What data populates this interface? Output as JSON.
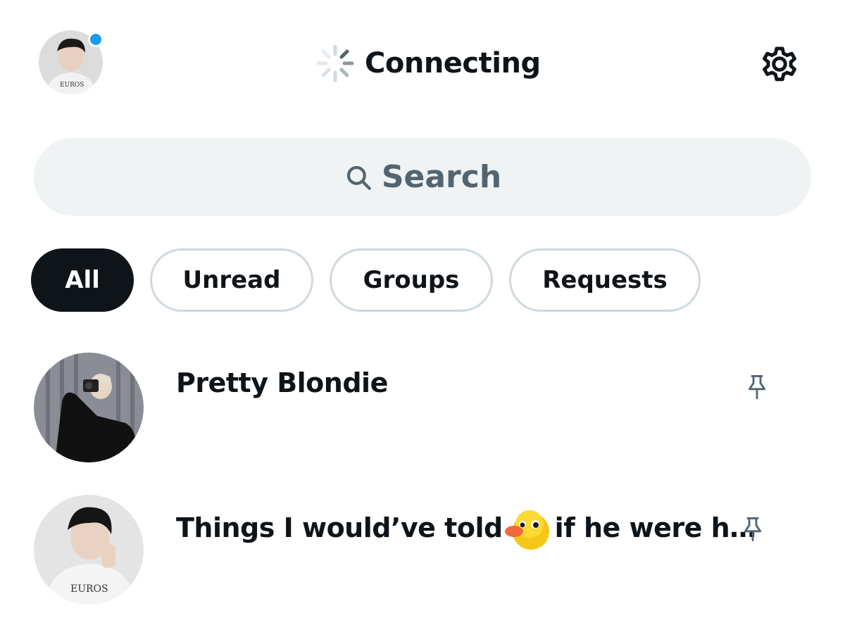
{
  "header": {
    "status_title": "Connecting",
    "has_notification_dot": true,
    "accent_color": "#1d9bf0"
  },
  "search": {
    "label": "Search"
  },
  "filters": [
    {
      "label": "All",
      "active": true
    },
    {
      "label": "Unread",
      "active": false
    },
    {
      "label": "Groups",
      "active": false
    },
    {
      "label": "Requests",
      "active": false
    }
  ],
  "conversations": [
    {
      "name": "Pretty Blondie",
      "pinned": true
    },
    {
      "name_before_emoji": "Things I would’ve told",
      "emoji": "duck-emoji",
      "name_after_emoji": "if he were h…",
      "pinned": true
    }
  ]
}
